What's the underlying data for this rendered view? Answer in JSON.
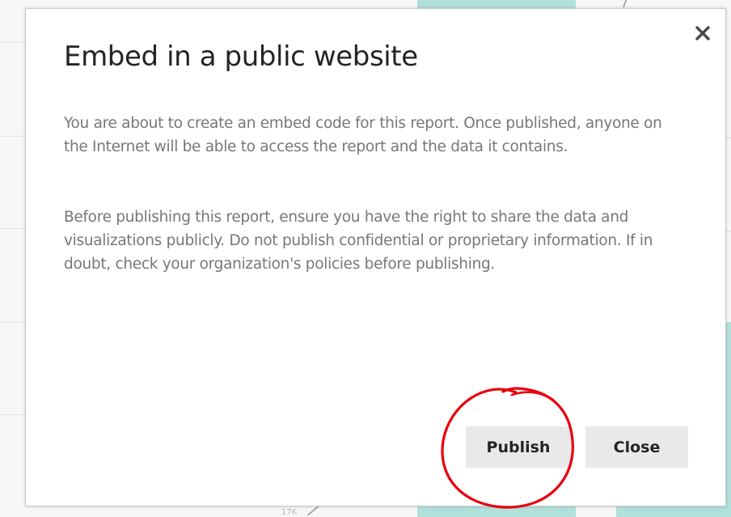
{
  "dialog": {
    "title": "Embed in a public website",
    "paragraph_1": "You are about to create an embed code for this report. Once published, anyone on the Internet will be able to access the report and the data it contains.",
    "paragraph_2": "Before publishing this report, ensure you have the right to share the data and visualizations publicly. Do not publish confidential or proprietary information. If in doubt, check your organization's policies before publishing.",
    "close_icon": "close-icon",
    "buttons": {
      "publish_label": "Publish",
      "close_label": "Close"
    }
  },
  "background": {
    "axis_label": "17K"
  },
  "colors": {
    "annotation_circle": "#e8000d",
    "button_bg": "#e9e9e9",
    "background_bar": "#b2e0da"
  }
}
